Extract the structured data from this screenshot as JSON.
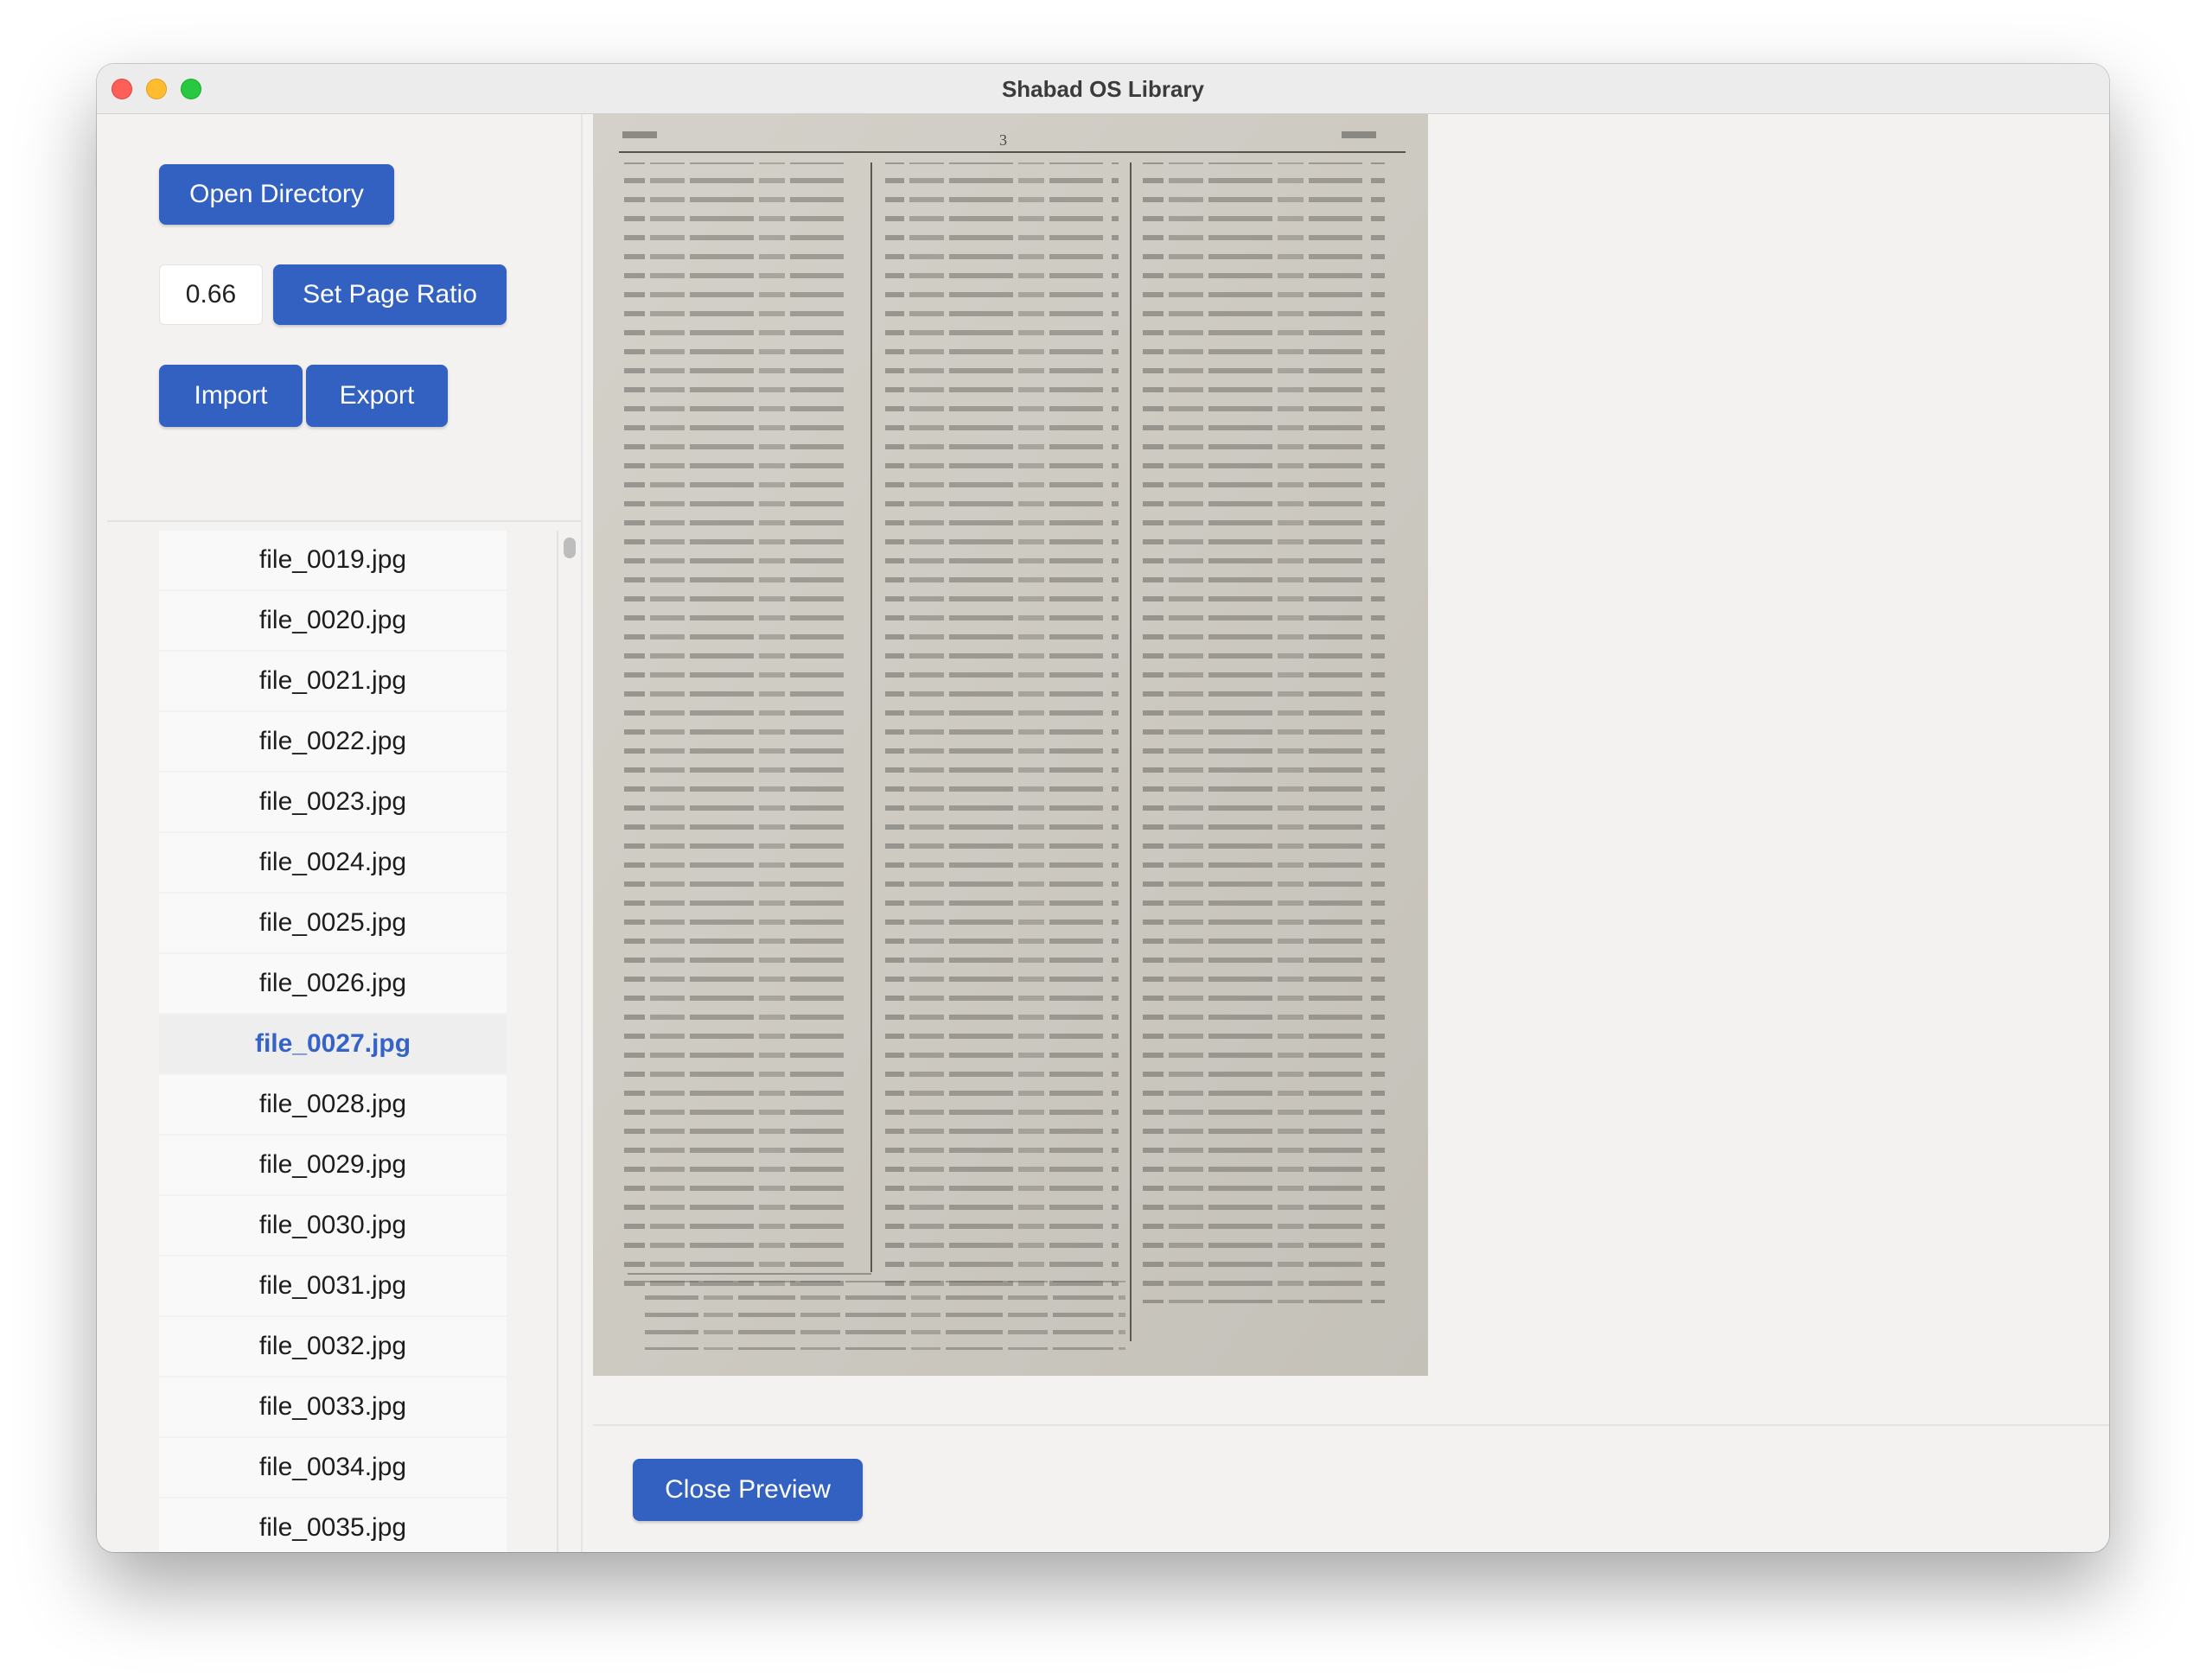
{
  "window": {
    "title": "Shabad OS Library"
  },
  "sidebar": {
    "open_directory_label": "Open Directory",
    "ratio_value": "0.66",
    "set_ratio_label": "Set Page Ratio",
    "import_label": "Import",
    "export_label": "Export"
  },
  "files": [
    "file_0019.jpg",
    "file_0020.jpg",
    "file_0021.jpg",
    "file_0022.jpg",
    "file_0023.jpg",
    "file_0024.jpg",
    "file_0025.jpg",
    "file_0026.jpg",
    "file_0027.jpg",
    "file_0028.jpg",
    "file_0029.jpg",
    "file_0030.jpg",
    "file_0031.jpg",
    "file_0032.jpg",
    "file_0033.jpg",
    "file_0034.jpg",
    "file_0035.jpg"
  ],
  "selected_file": "file_0027.jpg",
  "preview": {
    "page_number": "3",
    "close_label": "Close Preview"
  },
  "colors": {
    "accent": "#3261c2",
    "selected_text": "#3563c8",
    "window_bg": "#f3f2f1",
    "page_bg": "#cfccc4"
  }
}
